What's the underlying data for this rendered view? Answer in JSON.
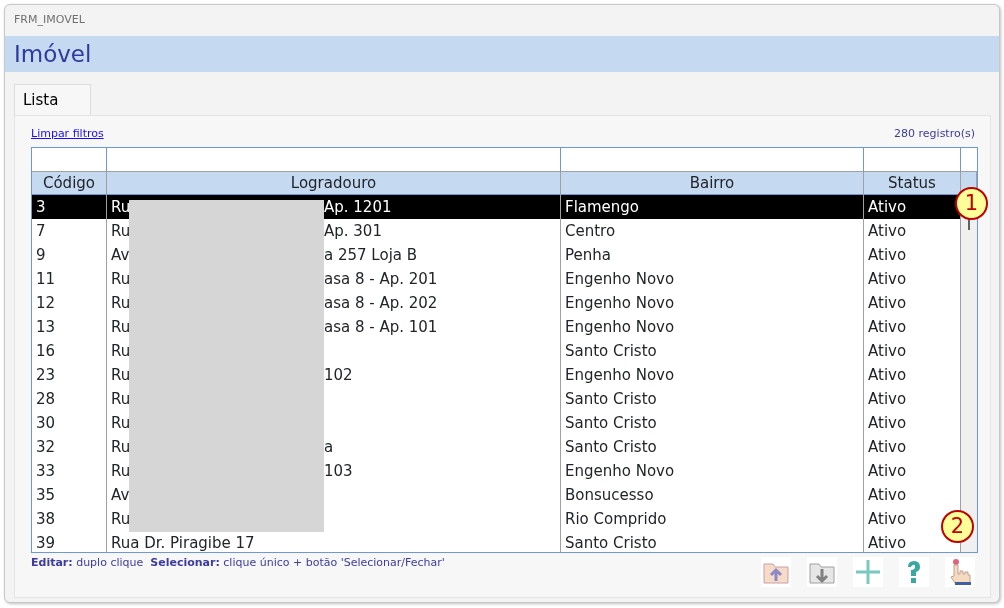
{
  "window": {
    "title": "FRM_IMOVEL"
  },
  "header": {
    "title": "Imóvel"
  },
  "tabs": [
    {
      "label": "Lista",
      "selected": true
    }
  ],
  "clear_filters_link": "Limpar filtros",
  "record_count": "280 registro(s)",
  "table": {
    "columns": [
      "Código",
      "Logradouro",
      "Bairro",
      "Status"
    ],
    "rows": [
      {
        "codigo": "3",
        "logradouro_start": "Ru",
        "logradouro_end": "Ap. 1201",
        "bairro": "Flamengo",
        "status": "Ativo",
        "selected": true
      },
      {
        "codigo": "7",
        "logradouro_start": "Ru",
        "logradouro_end": "Ap. 301",
        "bairro": "Centro",
        "status": "Ativo",
        "selected": false
      },
      {
        "codigo": "9",
        "logradouro_start": "Av",
        "logradouro_end": "a 257 Loja B",
        "bairro": "Penha",
        "status": "Ativo",
        "selected": false
      },
      {
        "codigo": "11",
        "logradouro_start": "Ru",
        "logradouro_end": "asa 8 - Ap. 201",
        "bairro": "Engenho Novo",
        "status": "Ativo",
        "selected": false
      },
      {
        "codigo": "12",
        "logradouro_start": "Ru",
        "logradouro_end": "asa 8 - Ap. 202",
        "bairro": "Engenho Novo",
        "status": "Ativo",
        "selected": false
      },
      {
        "codigo": "13",
        "logradouro_start": "Ru",
        "logradouro_end": "asa 8 - Ap. 101",
        "bairro": "Engenho Novo",
        "status": "Ativo",
        "selected": false
      },
      {
        "codigo": "16",
        "logradouro_start": "Ru",
        "bairro": "Santo Cristo",
        "status": "Ativo",
        "selected": false
      },
      {
        "codigo": "23",
        "logradouro_start": "Ru",
        "logradouro_end": "102",
        "bairro": "Engenho Novo",
        "status": "Ativo",
        "selected": false
      },
      {
        "codigo": "28",
        "logradouro_start": "Ru",
        "bairro": "Santo Cristo",
        "status": "Ativo",
        "selected": false
      },
      {
        "codigo": "30",
        "logradouro_start": "Ru",
        "bairro": "Santo Cristo",
        "status": "Ativo",
        "selected": false
      },
      {
        "codigo": "32",
        "logradouro_start": "Ru",
        "logradouro_end": "a",
        "bairro": "Santo Cristo",
        "status": "Ativo",
        "selected": false
      },
      {
        "codigo": "33",
        "logradouro_start": "Ru",
        "logradouro_end": "103",
        "bairro": "Engenho Novo",
        "status": "Ativo",
        "selected": false
      },
      {
        "codigo": "35",
        "logradouro_start": "Av",
        "bairro": "Bonsucesso",
        "status": "Ativo",
        "selected": false
      },
      {
        "codigo": "38",
        "logradouro_start": "Ru",
        "bairro": "Rio Comprido",
        "status": "Ativo",
        "selected": false
      },
      {
        "codigo": "39",
        "logradouro_start": "Rua Dr. Piragibe 17",
        "bairro": "Santo Cristo",
        "status": "Ativo",
        "selected": false
      }
    ]
  },
  "hint": "**Editar:** duplo clique  **Selecionar:** clique único + botão 'Selecionar/Fechar'",
  "toolbar": [
    {
      "kind": "folder-up"
    },
    {
      "kind": "folder-down"
    },
    {
      "kind": "plus"
    },
    {
      "kind": "help"
    },
    {
      "kind": "hand"
    }
  ],
  "callouts": [
    {
      "label": "1"
    },
    {
      "label": "2"
    }
  ]
}
